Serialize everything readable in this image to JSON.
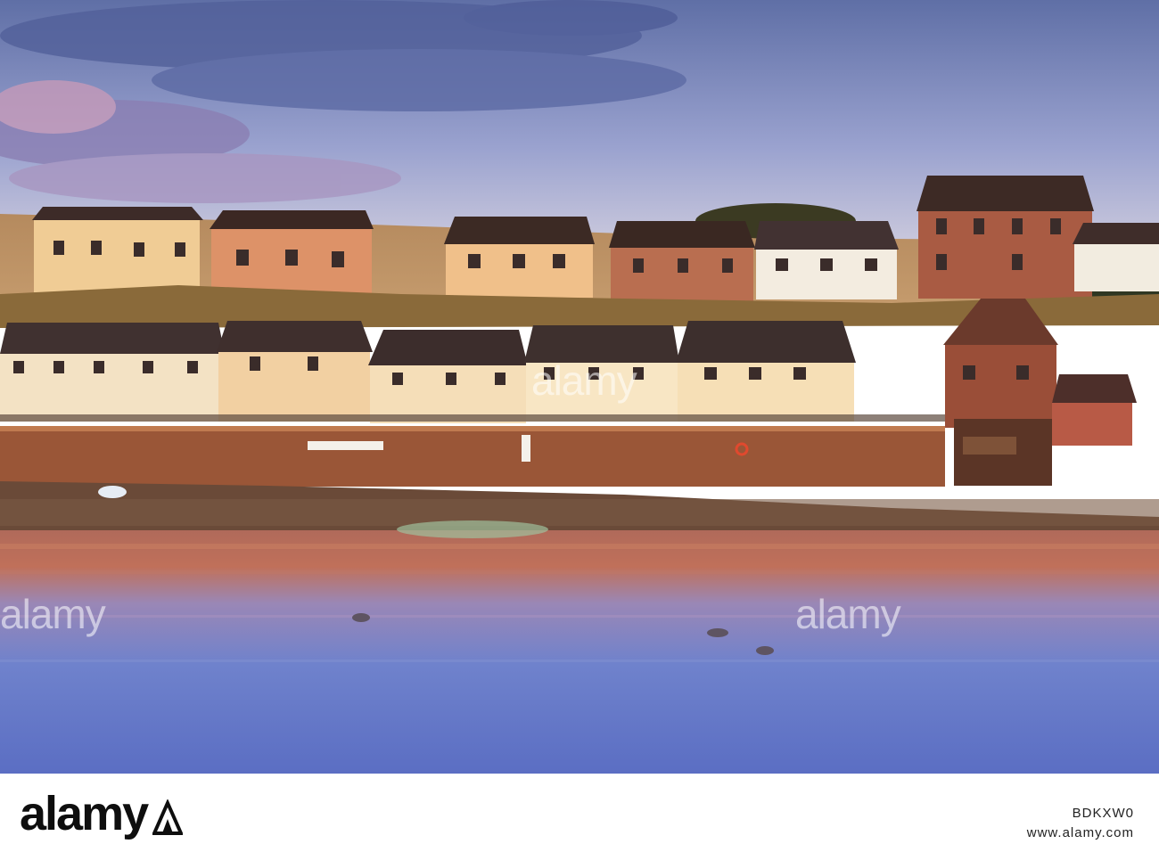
{
  "watermark": {
    "text": "alamy"
  },
  "footer": {
    "logo": "alamy",
    "image_id": "BDKXW0",
    "url": "www.alamy.com"
  },
  "colors": {
    "sky_top": "#5e6fa8",
    "sky_bottom": "#c7c8de",
    "water": "#6c7ec9",
    "wall": "#9a5637"
  }
}
